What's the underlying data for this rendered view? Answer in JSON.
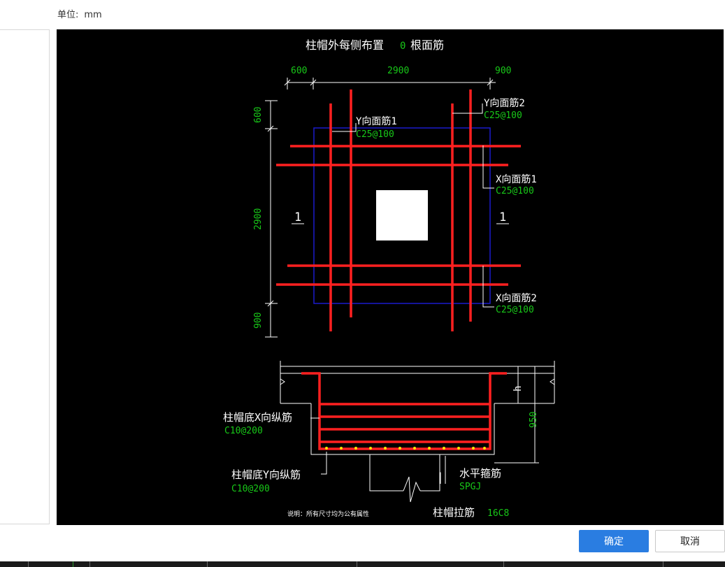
{
  "header": {
    "unit_label": "单位:",
    "unit_value": "mm"
  },
  "colors": {
    "rebar": "#ff2020",
    "dim_text": "#18c818",
    "boundary": "#1b1bcc",
    "stirrup_dot": "#ffe600",
    "primary": "#2a7de1"
  },
  "diagram": {
    "title_prefix": "柱帽外每侧布置",
    "title_count": "0",
    "title_suffix": "根面筋",
    "top_dims": [
      "600",
      "2900",
      "900"
    ],
    "side_dims": [
      "600",
      "2900",
      "900"
    ],
    "section_mark": "1",
    "callouts": {
      "y1_name": "Y向面筋1",
      "y1_spec": "C25@100",
      "y2_name": "Y向面筋2",
      "y2_spec": "C25@100",
      "x1_name": "X向面筋1",
      "x1_spec": "C25@100",
      "x2_name": "X向面筋2",
      "x2_spec": "C25@100"
    },
    "section": {
      "h_label": "h",
      "depth_label": "950",
      "bottom_x_name": "柱帽底X向纵筋",
      "bottom_x_spec": "C10@200",
      "bottom_y_name": "柱帽底Y向纵筋",
      "bottom_y_spec": "C10@200",
      "stirrup_name": "水平箍筋",
      "stirrup_spec": "SPGJ",
      "tie_name": "柱帽拉筋",
      "tie_spec": "16C8"
    },
    "note": "说明：所有尺寸均为公有属性"
  },
  "buttons": {
    "ok": "确定",
    "cancel": "取消"
  }
}
